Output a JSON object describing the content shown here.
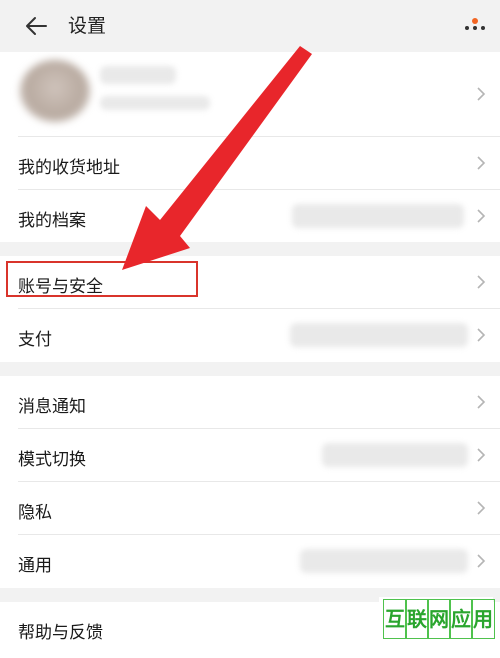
{
  "header": {
    "back_icon": "arrow-left-icon",
    "title": "设置",
    "more_icon": "more-dots-icon",
    "notification_dot_color": "#f26522"
  },
  "rows": [
    {
      "label": "我的收货地址"
    },
    {
      "label": "我的档案"
    },
    {
      "label": "账号与安全"
    },
    {
      "label": "支付"
    },
    {
      "label": "消息通知"
    },
    {
      "label": "模式切换"
    },
    {
      "label": "隐私"
    },
    {
      "label": "通用"
    },
    {
      "label": "帮助与反馈"
    }
  ],
  "annotation": {
    "arrow_color": "#e8262b",
    "highlight_color": "#d9342b"
  },
  "watermark": {
    "chars": [
      "互",
      "联",
      "网",
      "应",
      "用"
    ],
    "color": "#2aa52e"
  }
}
